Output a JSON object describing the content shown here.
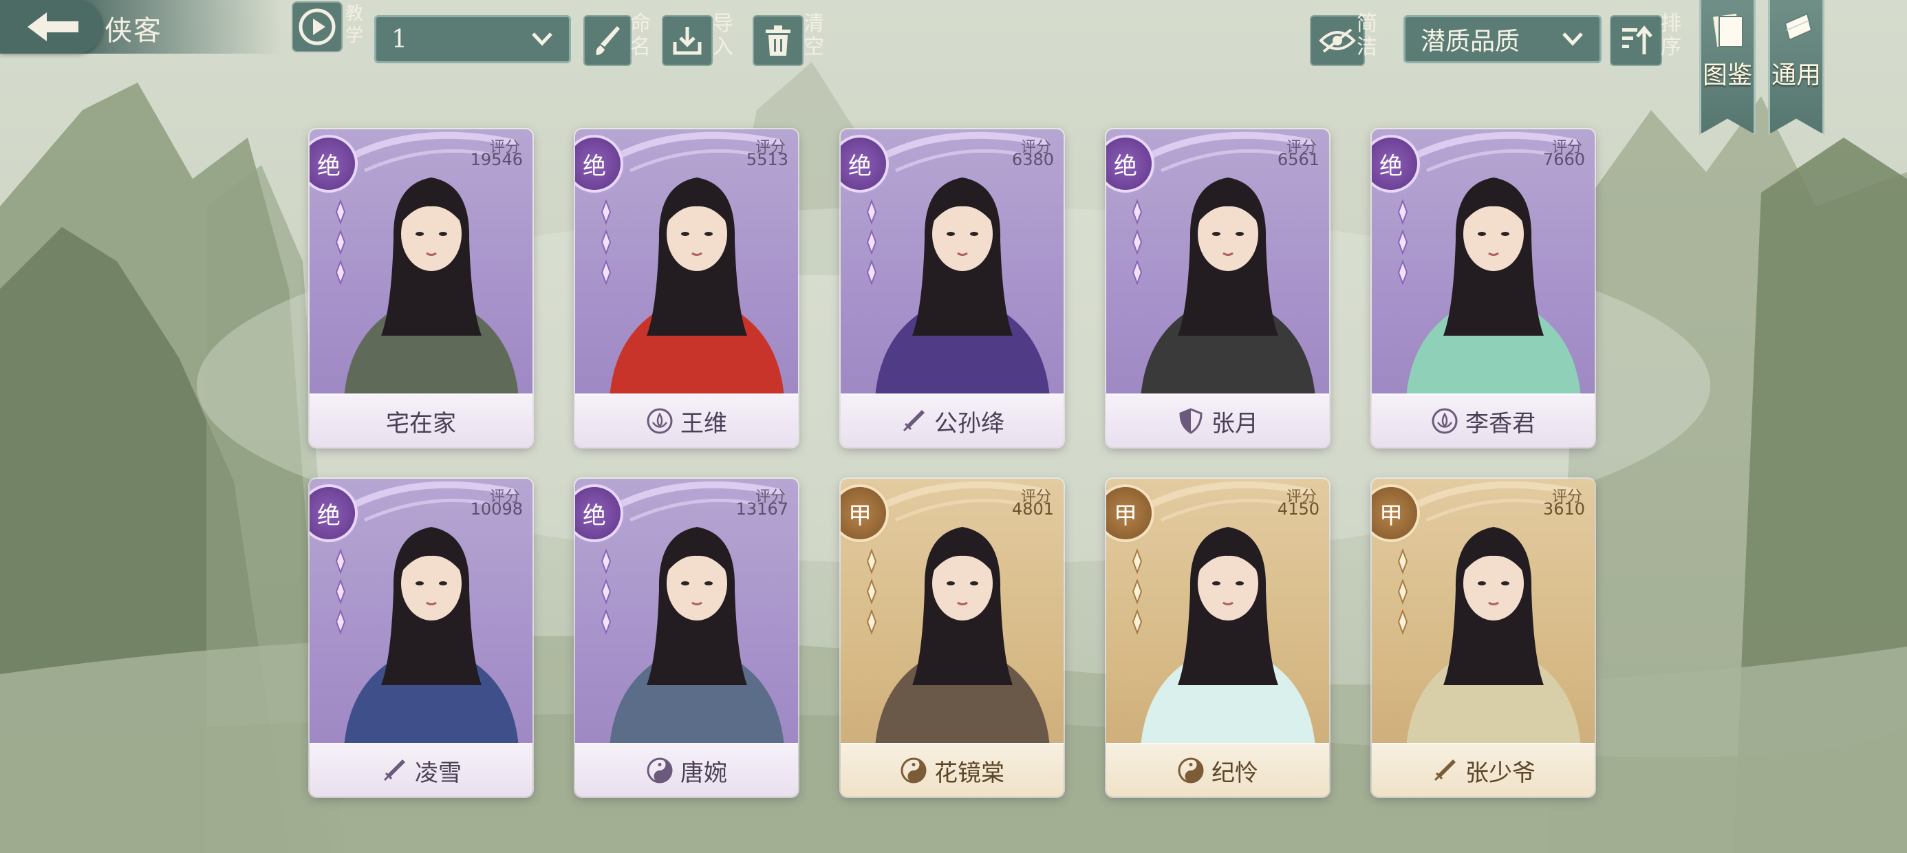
{
  "header": {
    "title": "侠客",
    "tutorial_label": "教学",
    "team_select_value": "1",
    "rename_label": "命名",
    "import_label": "导入",
    "clear_label": "清空",
    "simple_label": "简洁",
    "sort_select_value": "潜质品质",
    "sort_label": "排序"
  },
  "side_banners": [
    {
      "label": "图鉴"
    },
    {
      "label": "通用"
    }
  ],
  "score_label": "评分",
  "colors": {
    "jue_card": "#a590c9",
    "jia_card": "#d6b985",
    "toolbar": "#5b7c75"
  },
  "cards": [
    {
      "grade": "绝",
      "score": "19546",
      "name": "宅在家",
      "faction_icon": "none",
      "rarity": "jue",
      "stars": 3
    },
    {
      "grade": "绝",
      "score": "5513",
      "name": "王维",
      "faction_icon": "lotus-icon",
      "rarity": "jue",
      "stars": 3
    },
    {
      "grade": "绝",
      "score": "6380",
      "name": "公孙绛",
      "faction_icon": "sword-icon",
      "rarity": "jue",
      "stars": 3
    },
    {
      "grade": "绝",
      "score": "6561",
      "name": "张月",
      "faction_icon": "shield-icon",
      "rarity": "jue",
      "stars": 3
    },
    {
      "grade": "绝",
      "score": "7660",
      "name": "李香君",
      "faction_icon": "lotus-icon",
      "rarity": "jue",
      "stars": 3
    },
    {
      "grade": "绝",
      "score": "10098",
      "name": "凌雪",
      "faction_icon": "sword-icon",
      "rarity": "jue",
      "stars": 3
    },
    {
      "grade": "绝",
      "score": "13167",
      "name": "唐婉",
      "faction_icon": "taiji-icon",
      "rarity": "jue",
      "stars": 3
    },
    {
      "grade": "甲",
      "score": "4801",
      "name": "花镜棠",
      "faction_icon": "taiji-icon",
      "rarity": "jia",
      "stars": 3
    },
    {
      "grade": "甲",
      "score": "4150",
      "name": "纪怜",
      "faction_icon": "taiji-icon",
      "rarity": "jia",
      "stars": 3
    },
    {
      "grade": "甲",
      "score": "3610",
      "name": "张少爷",
      "faction_icon": "sword-icon",
      "rarity": "jia",
      "stars": 3
    }
  ]
}
